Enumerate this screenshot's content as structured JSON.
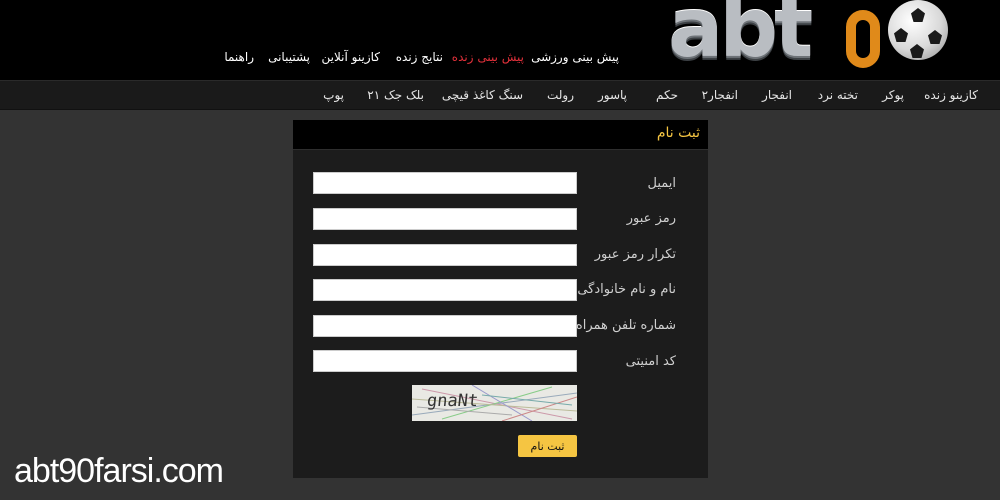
{
  "header": {
    "logo": "abt90",
    "top_nav": [
      "پیش بینی ورزشی",
      "پیش بینی زنده",
      "نتایج زنده",
      "کازینو آنلاین",
      "پشتیبانی",
      "راهنما"
    ]
  },
  "sub_nav": [
    "کازینو زنده",
    "پوکر",
    "تخته نرد",
    "انفجار",
    "انفجار۲",
    "حکم",
    "پاسور",
    "رولت",
    "سنگ کاغذ قیچی",
    "بلک جک ۲۱",
    "پوپ"
  ],
  "form": {
    "title": "ثبت نام",
    "fields": {
      "email": "ایمیل",
      "password": "رمز عبور",
      "password_repeat": "تکرار رمز عبور",
      "full_name": "نام و نام خانوادگی",
      "phone": "شماره تلفن همراه",
      "captcha_code": "کد امنیتی"
    },
    "captcha_text": "gnaNt",
    "submit_label": "ثبت نام"
  },
  "watermark": "abt90farsi.com",
  "colors": {
    "accent": "#f5c542",
    "active_nav": "#e0303a",
    "background": "#333333"
  }
}
